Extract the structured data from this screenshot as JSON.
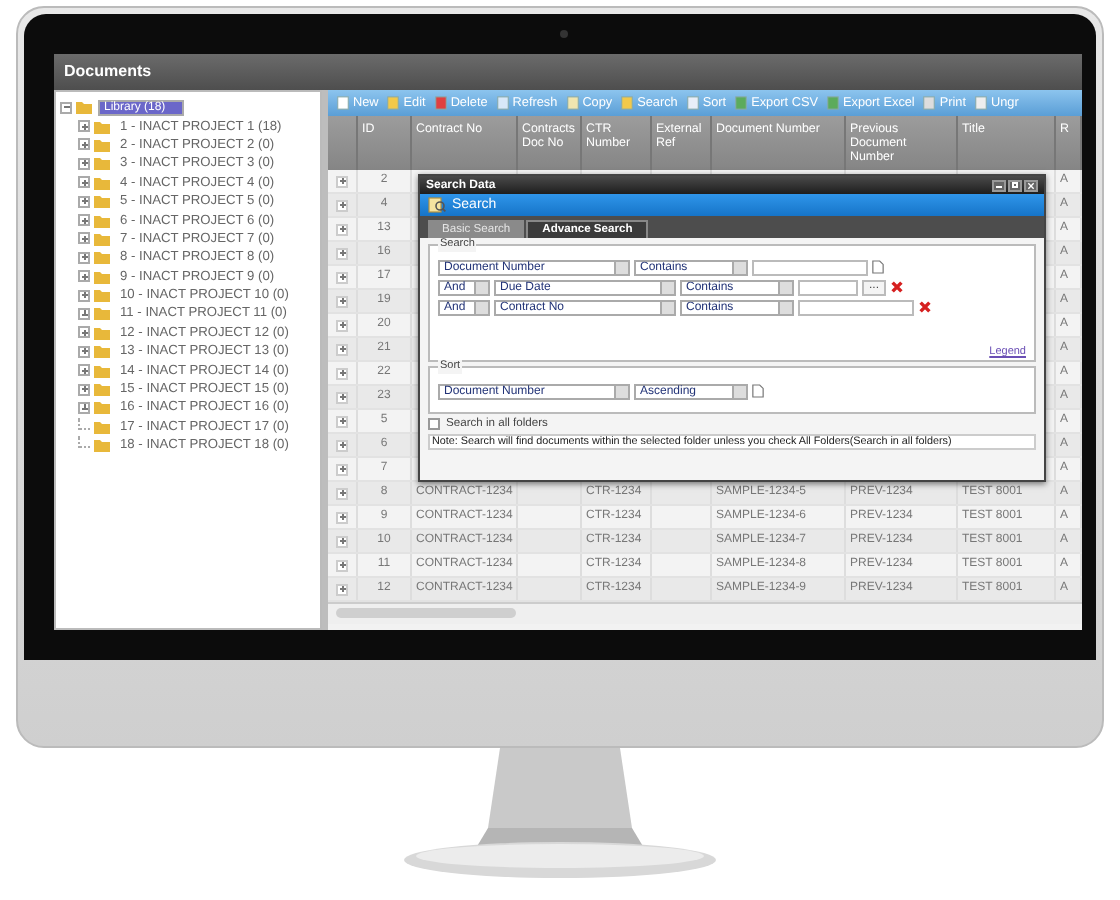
{
  "window": {
    "title": "Documents"
  },
  "tree": {
    "label": "Library (18)",
    "selected": true,
    "expanded": true,
    "children": [
      {
        "label": "1 - INACT PROJECT 1 (18)",
        "selected": false,
        "has_children": true
      },
      {
        "label": "2 - INACT PROJECT 2 (0)",
        "selected": false,
        "has_children": true
      },
      {
        "label": "3 - INACT PROJECT 3 (0)",
        "selected": false,
        "has_children": true
      },
      {
        "label": "4 - INACT PROJECT 4 (0)",
        "selected": false,
        "has_children": true
      },
      {
        "label": "5 - INACT PROJECT 5 (0)",
        "selected": false,
        "has_children": true
      },
      {
        "label": "6 - INACT PROJECT 6 (0)",
        "selected": false,
        "has_children": true
      },
      {
        "label": "7 - INACT PROJECT 7 (0)",
        "selected": false,
        "has_children": true
      },
      {
        "label": "8 - INACT PROJECT 8 (0)",
        "selected": false,
        "has_children": true
      },
      {
        "label": "9 - INACT PROJECT 9 (0)",
        "selected": false,
        "has_children": true
      },
      {
        "label": "10 - INACT PROJECT 10 (0)",
        "selected": false,
        "has_children": true
      },
      {
        "label": "11 - INACT PROJECT 11 (0)",
        "selected": false,
        "has_children": true
      },
      {
        "label": "12 - INACT PROJECT 12 (0)",
        "selected": false,
        "has_children": true
      },
      {
        "label": "13 - INACT PROJECT 13 (0)",
        "selected": false,
        "has_children": true
      },
      {
        "label": "14 - INACT PROJECT 14 (0)",
        "selected": false,
        "has_children": true
      },
      {
        "label": "15 - INACT PROJECT 15 (0)",
        "selected": false,
        "has_children": true
      },
      {
        "label": "16 - INACT PROJECT 16 (0)",
        "selected": false,
        "has_children": true
      },
      {
        "label": "17 - INACT PROJECT 17 (0)",
        "selected": false,
        "has_children": false
      },
      {
        "label": "18 - INACT PROJECT 18 (0)",
        "selected": false,
        "has_children": false
      }
    ]
  },
  "toolbar": [
    "New",
    "Edit",
    "Delete",
    "Refresh",
    "Copy",
    "Search",
    "Sort",
    "Export CSV",
    "Export Excel",
    "Print",
    "Ungr"
  ],
  "table": {
    "columns": [
      "ID",
      "Contract No",
      "Contracts Doc No",
      "CTR Number",
      "External Ref",
      "Document Number",
      "Previous Document Number",
      "Title",
      "R"
    ],
    "rows": [
      {
        "cells": [
          "2",
          null,
          null,
          null,
          null,
          null,
          null,
          null,
          "A"
        ]
      },
      {
        "cells": [
          "4",
          null,
          null,
          null,
          null,
          null,
          null,
          null,
          "A"
        ]
      },
      {
        "cells": [
          "13",
          null,
          null,
          null,
          null,
          null,
          null,
          null,
          "A"
        ]
      },
      {
        "cells": [
          "16",
          null,
          null,
          null,
          null,
          null,
          null,
          null,
          "A"
        ]
      },
      {
        "cells": [
          "17",
          null,
          null,
          null,
          null,
          null,
          null,
          null,
          "A"
        ]
      },
      {
        "cells": [
          "19",
          null,
          null,
          null,
          null,
          null,
          null,
          null,
          "A"
        ]
      },
      {
        "cells": [
          "20",
          null,
          null,
          null,
          null,
          null,
          null,
          null,
          "A"
        ]
      },
      {
        "cells": [
          "21",
          null,
          null,
          null,
          null,
          null,
          null,
          null,
          "A"
        ]
      },
      {
        "cells": [
          "22",
          null,
          null,
          null,
          null,
          null,
          null,
          null,
          "A"
        ]
      },
      {
        "cells": [
          "23",
          null,
          null,
          null,
          null,
          null,
          null,
          null,
          "A"
        ]
      },
      {
        "cells": [
          "5",
          null,
          null,
          null,
          null,
          null,
          null,
          null,
          "A"
        ]
      },
      {
        "cells": [
          "6",
          null,
          null,
          null,
          null,
          null,
          null,
          null,
          "A"
        ]
      },
      {
        "cells": [
          "7",
          null,
          null,
          null,
          null,
          null,
          null,
          null,
          "A"
        ]
      },
      {
        "cells": [
          "8",
          "CONTRACT-1234",
          null,
          "CTR-1234",
          null,
          "SAMPLE-1234-5",
          "PREV-1234",
          "TEST 8001",
          "A"
        ]
      },
      {
        "cells": [
          "9",
          "CONTRACT-1234",
          null,
          "CTR-1234",
          null,
          "SAMPLE-1234-6",
          "PREV-1234",
          "TEST 8001",
          "A"
        ]
      },
      {
        "cells": [
          "10",
          "CONTRACT-1234",
          null,
          "CTR-1234",
          null,
          "SAMPLE-1234-7",
          "PREV-1234",
          "TEST 8001",
          "A"
        ]
      },
      {
        "cells": [
          "11",
          "CONTRACT-1234",
          null,
          "CTR-1234",
          null,
          "SAMPLE-1234-8",
          "PREV-1234",
          "TEST 8001",
          "A"
        ]
      },
      {
        "cells": [
          "12",
          "CONTRACT-1234",
          null,
          "CTR-1234",
          null,
          "SAMPLE-1234-9",
          "PREV-1234",
          "TEST 8001",
          "A"
        ]
      }
    ]
  },
  "search_dialog": {
    "title": "Search Data",
    "header": "Search",
    "tabs": [
      {
        "label": "Basic Search",
        "selected": false
      },
      {
        "label": "Advance Search",
        "selected": true
      }
    ],
    "search_group": {
      "legend": "Search",
      "conditions": [
        {
          "field": "Document Number",
          "operator": "Contains"
        },
        {
          "conjunction": "And",
          "field": "Due Date",
          "operator": "Contains",
          "picker": "..."
        },
        {
          "conjunction": "And",
          "field": "Contract No",
          "operator": "Contains"
        }
      ],
      "legend_link": "Legend"
    },
    "sort_group": {
      "legend": "Sort",
      "field": "Document Number",
      "order": "Ascending"
    },
    "search_all_folders": {
      "label": "Search in all folders",
      "checked": false
    },
    "note": "Note: Search will find documents within the selected folder unless you check All Folders(Search in all folders)"
  }
}
